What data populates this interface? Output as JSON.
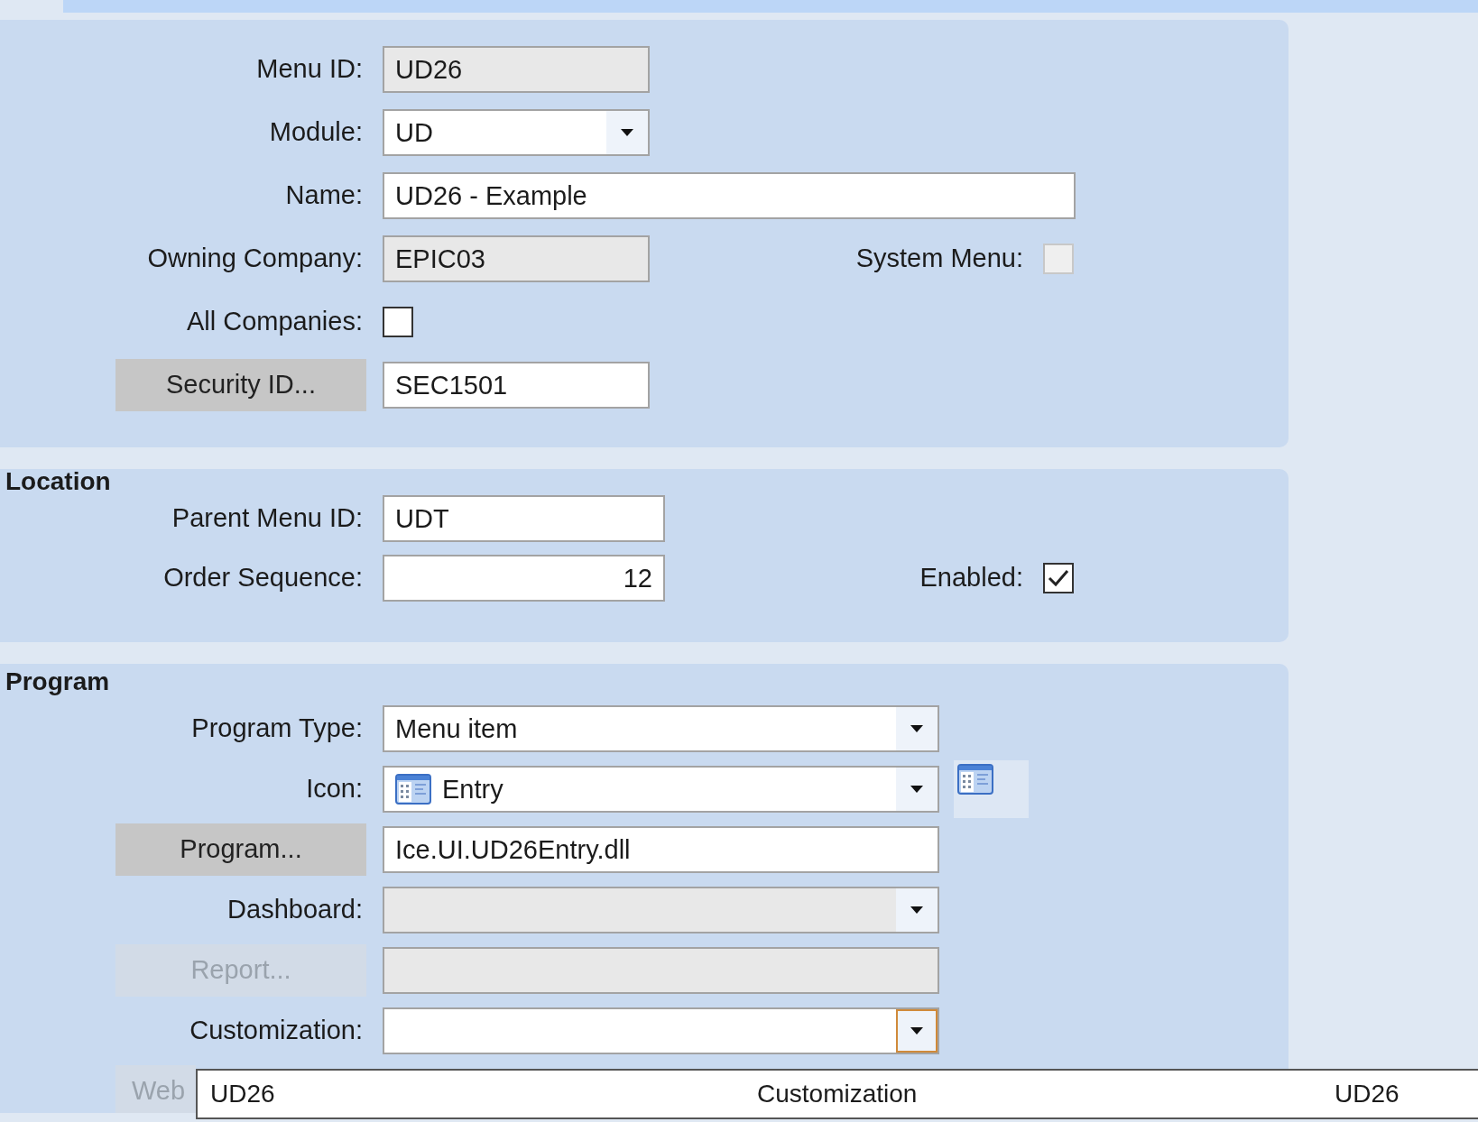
{
  "sections": [
    {
      "rows": [
        {
          "kind": "text",
          "label": "Menu ID:",
          "value": "UD26",
          "disabled": true
        },
        {
          "kind": "select",
          "label": "Module:",
          "value": "UD",
          "disabled": false
        },
        {
          "kind": "text",
          "label": "Name:",
          "value": "UD26 - Example",
          "disabled": false
        },
        {
          "kind": "text",
          "label": "Owning Company:",
          "value": "EPIC03",
          "disabled": true,
          "extra": {
            "label": "System Menu:",
            "checked": false,
            "disabled": true
          }
        },
        {
          "kind": "checkbox",
          "label": "All Companies:",
          "checked": false
        },
        {
          "kind": "button-field",
          "button": "Security ID...",
          "value": "SEC1501",
          "disabled": false
        }
      ]
    },
    {
      "title": "Location",
      "rows": [
        {
          "kind": "text",
          "label": "Parent Menu ID:",
          "value": "UDT",
          "disabled": false
        },
        {
          "kind": "text",
          "label": "Order Sequence:",
          "value": "12",
          "disabled": false,
          "extra": {
            "label": "Enabled:",
            "checked": true,
            "disabled": false
          }
        }
      ]
    },
    {
      "title": "Program",
      "rows": [
        {
          "kind": "select",
          "label": "Program Type:",
          "value": "Menu item",
          "disabled": false
        },
        {
          "kind": "icon-select",
          "label": "Icon:",
          "value": "Entry",
          "disabled": false
        },
        {
          "kind": "button-field",
          "button": "Program...",
          "value": "Ice.UI.UD26Entry.dll",
          "disabled": false
        },
        {
          "kind": "select",
          "label": "Dashboard:",
          "disabled": true
        },
        {
          "kind": "button-field",
          "button": "Report...",
          "disabled": true
        },
        {
          "kind": "select",
          "label": "Customization:",
          "disabled": false,
          "focused": true
        },
        {
          "kind": "button",
          "button": "Web",
          "disabled": true
        }
      ]
    }
  ],
  "dropdown_list": {
    "rows": [
      {
        "cells": [
          "UD26",
          "Customization",
          "UD26"
        ]
      }
    ]
  }
}
